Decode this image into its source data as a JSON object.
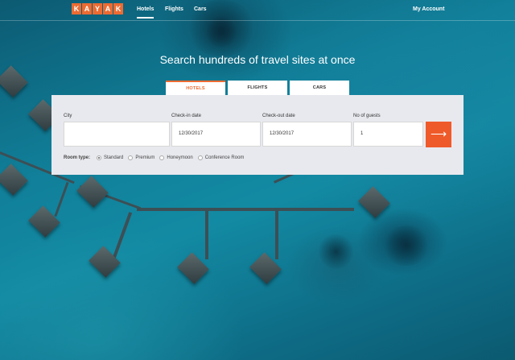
{
  "brand": {
    "logo_letters": [
      "K",
      "A",
      "Y",
      "A",
      "K"
    ],
    "accent_color": "#ec6b32",
    "button_color": "#ef5a2a"
  },
  "nav": {
    "hotels": "Hotels",
    "flights": "Flights",
    "cars": "Cars",
    "account": "My Account",
    "active": "hotels"
  },
  "hero": {
    "title": "Search hundreds of travel sites at once"
  },
  "tabs": [
    {
      "label": "HOTELS",
      "active": true
    },
    {
      "label": "FLIGHTS",
      "active": false
    },
    {
      "label": "CARS",
      "active": false
    }
  ],
  "search": {
    "city": {
      "label": "City",
      "value": ""
    },
    "checkin": {
      "label": "Check-in date",
      "value": "12/30/2017"
    },
    "checkout": {
      "label": "Check-out date",
      "value": "12/30/2017"
    },
    "guests": {
      "label": "No of guests",
      "value": "1"
    },
    "submit_icon": "arrow-right-icon"
  },
  "room_type": {
    "label": "Room type:",
    "options": [
      {
        "label": "Standard",
        "checked": true
      },
      {
        "label": "Premium",
        "checked": false
      },
      {
        "label": "Honeymoon",
        "checked": false
      },
      {
        "label": "Conference Room",
        "checked": false
      }
    ]
  }
}
